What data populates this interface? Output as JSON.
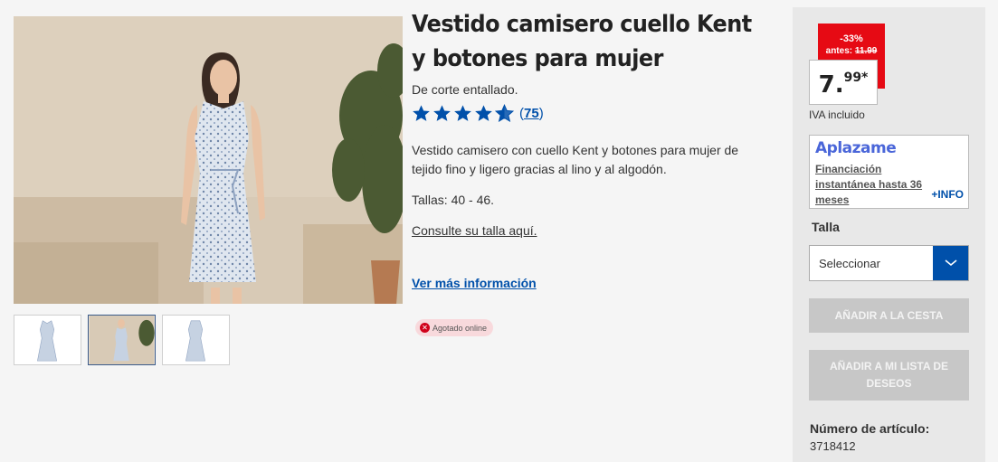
{
  "product": {
    "title": "Vestido camisero cuello Kent y botones para mujer",
    "subtitle": "De corte entallado.",
    "rating": {
      "value": 4.5,
      "max": 5,
      "count_label": "75"
    },
    "description": "Vestido camisero con cuello Kent y botones para mujer de tejido fino y ligero gracias al lino y al algodón.",
    "sizes": "Tallas: 40 - 46.",
    "size_link": "Consulte su talla aquí.",
    "more_info_link": "Ver más información",
    "stock_badge": "Agotado online",
    "stock_icon": "x-circle-icon"
  },
  "gallery": {
    "thumbnails": [
      {
        "name": "dress-front",
        "active": false
      },
      {
        "name": "model-wearing-dress",
        "active": true
      },
      {
        "name": "dress-back",
        "active": false
      }
    ]
  },
  "pricing": {
    "discount": "-33%",
    "before_prefix": "antes:",
    "before_price": "11.99",
    "price_int": "7.",
    "price_dec": "99*",
    "tax_note": "IVA incluido"
  },
  "aplazame": {
    "logo": "Aplazame",
    "text": "Financiación instantánea hasta 36 meses",
    "more": "+INFO"
  },
  "size_select": {
    "label": "Talla",
    "placeholder": "Seleccionar"
  },
  "actions": {
    "add_to_cart": "AÑADIR A LA CESTA",
    "add_to_wishlist": "AÑADIR A MI LISTA DE DESEOS"
  },
  "article": {
    "label": "Número de artículo:",
    "number": "3718412"
  },
  "colors": {
    "brand_blue": "#0050aa",
    "sale_red": "#e60a14",
    "star_blue": "#0050aa",
    "disabled_button": "#c7c7c7",
    "aplazame_blue": "#4a66d9"
  }
}
